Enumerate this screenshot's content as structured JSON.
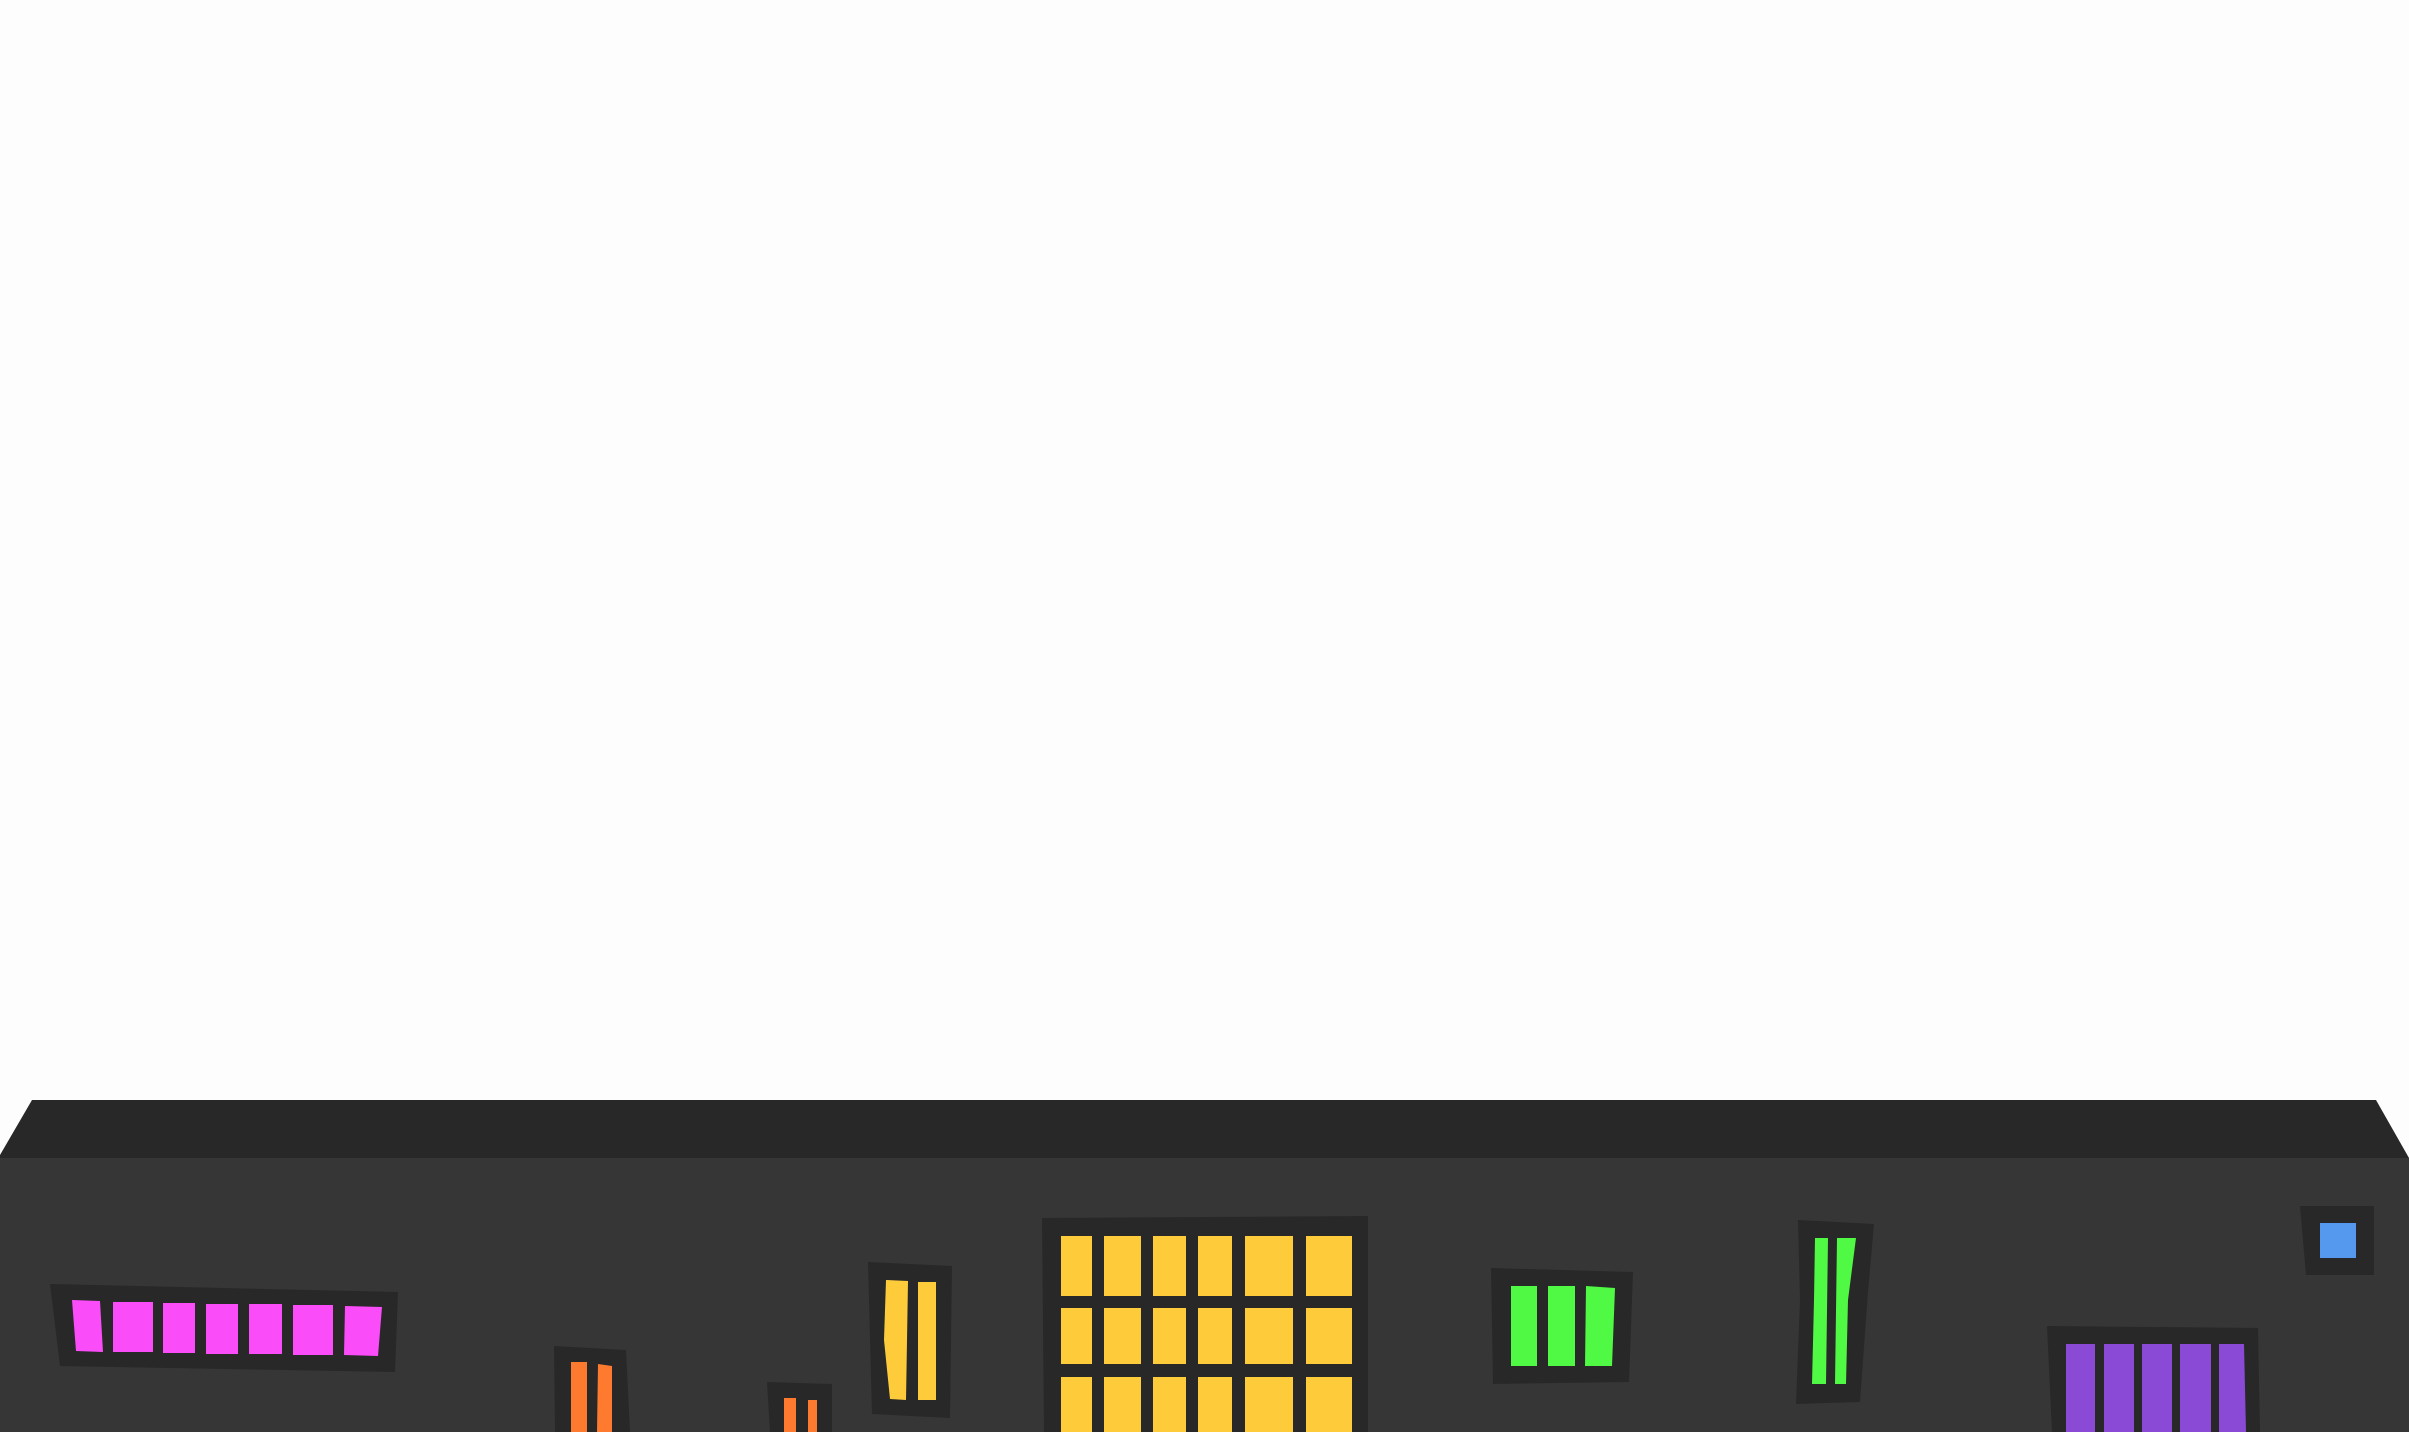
{
  "scene": {
    "background_color": "#fdfdfd",
    "panel_top_color": "#282828",
    "panel_face_color": "#363636",
    "frame_color": "#282828"
  },
  "colors": {
    "magenta": "#fb4cf9",
    "orange": "#fd7a2f",
    "yellow": "#fecc3b",
    "green": "#50f944",
    "purple": "#8a4ad6",
    "blue": "#5599ee"
  }
}
